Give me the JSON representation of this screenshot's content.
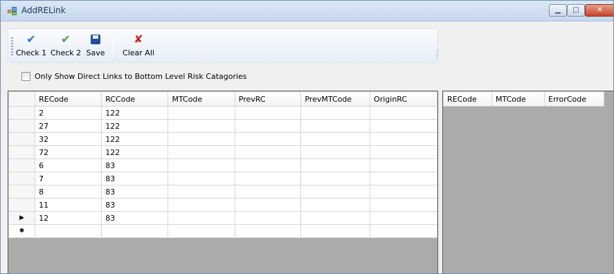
{
  "window": {
    "title": "AddRELink",
    "min_glyph": "▁",
    "max_glyph": "□",
    "close_glyph": "✕"
  },
  "toolbar": {
    "buttons": [
      {
        "label": "Check 1",
        "icon": "check-blue-icon"
      },
      {
        "label": "Check 2",
        "icon": "check-green-icon"
      },
      {
        "label": "Save",
        "icon": "floppy-disk-icon"
      },
      {
        "label": "Clear All",
        "icon": "red-x-icon"
      }
    ]
  },
  "filter": {
    "label": "Only Show Direct Links to Bottom Level Risk Catagories",
    "checked": false
  },
  "main_grid": {
    "columns": [
      "RECode",
      "RCCode",
      "MTCode",
      "PrevRC",
      "PrevMTCode",
      "OriginRC"
    ],
    "rows": [
      {
        "marker": "",
        "cells": [
          "2",
          "122",
          "",
          "",
          "",
          ""
        ]
      },
      {
        "marker": "",
        "cells": [
          "27",
          "122",
          "",
          "",
          "",
          ""
        ]
      },
      {
        "marker": "",
        "cells": [
          "32",
          "122",
          "",
          "",
          "",
          ""
        ]
      },
      {
        "marker": "",
        "cells": [
          "72",
          "122",
          "",
          "",
          "",
          ""
        ]
      },
      {
        "marker": "",
        "cells": [
          "6",
          "83",
          "",
          "",
          "",
          ""
        ]
      },
      {
        "marker": "",
        "cells": [
          "7",
          "83",
          "",
          "",
          "",
          ""
        ]
      },
      {
        "marker": "",
        "cells": [
          "8",
          "83",
          "",
          "",
          "",
          ""
        ]
      },
      {
        "marker": "",
        "cells": [
          "11",
          "83",
          "",
          "",
          "",
          ""
        ]
      },
      {
        "marker": "▶",
        "cells": [
          "12",
          "83",
          "",
          "",
          "",
          ""
        ]
      }
    ],
    "new_row_marker": "✱"
  },
  "error_grid": {
    "columns": [
      "RECode",
      "MTCode",
      "ErrorCode"
    ]
  },
  "colors": {
    "selection": "#3399ff",
    "grid_background": "#ababab"
  }
}
